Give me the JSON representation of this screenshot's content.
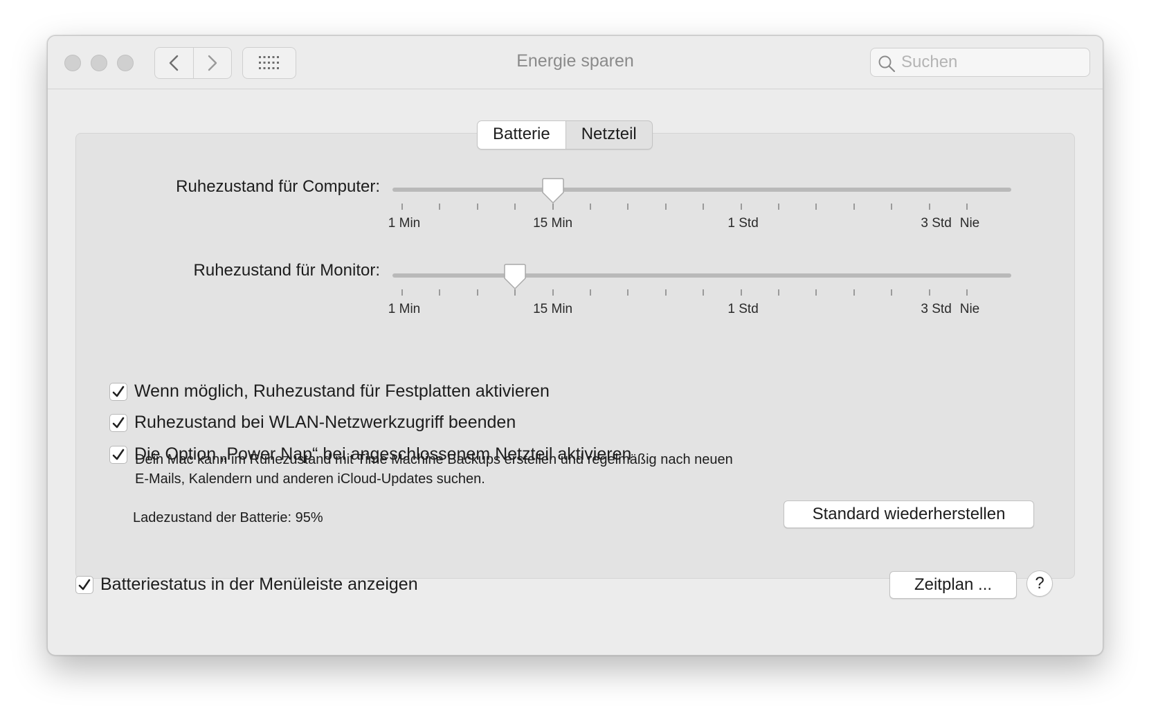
{
  "window": {
    "title": "Energie sparen"
  },
  "toolbar": {
    "back_icon": "chevron-left-icon",
    "forward_icon": "chevron-right-icon",
    "grid_icon": "grid-icon"
  },
  "search": {
    "placeholder": "Suchen",
    "value": "",
    "icon": "search-icon"
  },
  "tabs": [
    {
      "label": "Batterie",
      "selected": true
    },
    {
      "label": "Netzteil",
      "selected": false
    }
  ],
  "sliders": {
    "tick_count": 16,
    "tick_labels": [
      "1 Min",
      "15 Min",
      "1 Std",
      "3 Std",
      "Nie"
    ],
    "computer": {
      "label": "Ruhezustand für Computer:",
      "value": "15 Min"
    },
    "monitor": {
      "label": "Ruhezustand für Monitor:",
      "value": "15 Min"
    }
  },
  "options": [
    {
      "label": "Wenn möglich, Ruhezustand für Festplatten aktivieren",
      "checked": true
    },
    {
      "label": "Ruhezustand bei WLAN-Netzwerkzugriff beenden",
      "checked": true
    },
    {
      "label": "Die Option „Power Nap“ bei angeschlossenem Netzteil aktivieren",
      "checked": true
    }
  ],
  "power_nap_description": [
    "Dein Mac kann im Ruhezustand mit Time Machine Backups erstellen und regelmäßig nach neuen",
    "E-Mails, Kalendern und anderen iCloud-Updates suchen."
  ],
  "battery_status": "Ladezustand der Batterie: 95%",
  "restore_defaults_label": "Standard wiederherstellen",
  "footer": {
    "show_battery_status": {
      "label": "Batteriestatus in der Menüleiste anzeigen",
      "checked": true
    },
    "schedule_label": "Zeitplan ...",
    "help_label": "?"
  }
}
